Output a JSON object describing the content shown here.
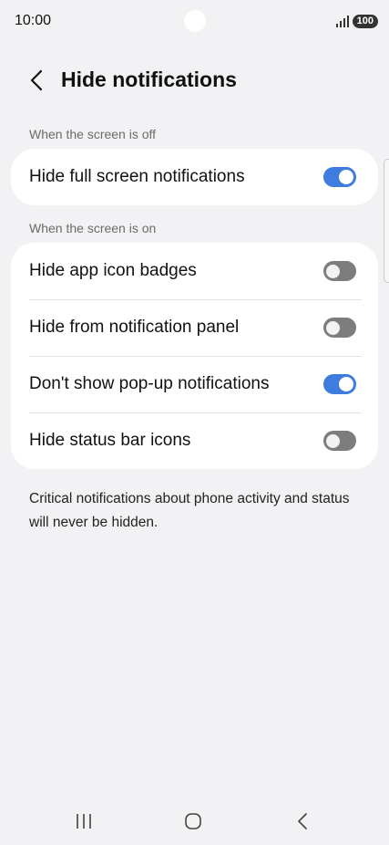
{
  "status_bar": {
    "time": "10:00",
    "battery": "100",
    "signal_icon": "signal-bars-icon"
  },
  "header": {
    "back_icon": "chevron-left-icon",
    "title": "Hide notifications"
  },
  "section_off": {
    "label": "When the screen is off",
    "items": [
      {
        "label": "Hide full screen notifications",
        "enabled": true
      }
    ]
  },
  "section_on": {
    "label": "When the screen is on",
    "items": [
      {
        "label": "Hide app icon badges",
        "enabled": false
      },
      {
        "label": "Hide from notification panel",
        "enabled": false
      },
      {
        "label": "Don't show pop-up notifications",
        "enabled": true
      },
      {
        "label": "Hide status bar icons",
        "enabled": false
      }
    ]
  },
  "footnote": "Critical notifications about phone activity and status will never be hidden.",
  "nav_bar": {
    "recents_icon": "recents-icon",
    "home_icon": "home-icon",
    "back_icon": "back-icon"
  },
  "colors": {
    "background": "#f2f2f4",
    "card": "#ffffff",
    "toggle_on": "#3f7ce0",
    "toggle_off": "#7d7d7f",
    "secondary_text": "#6b6b6b"
  }
}
